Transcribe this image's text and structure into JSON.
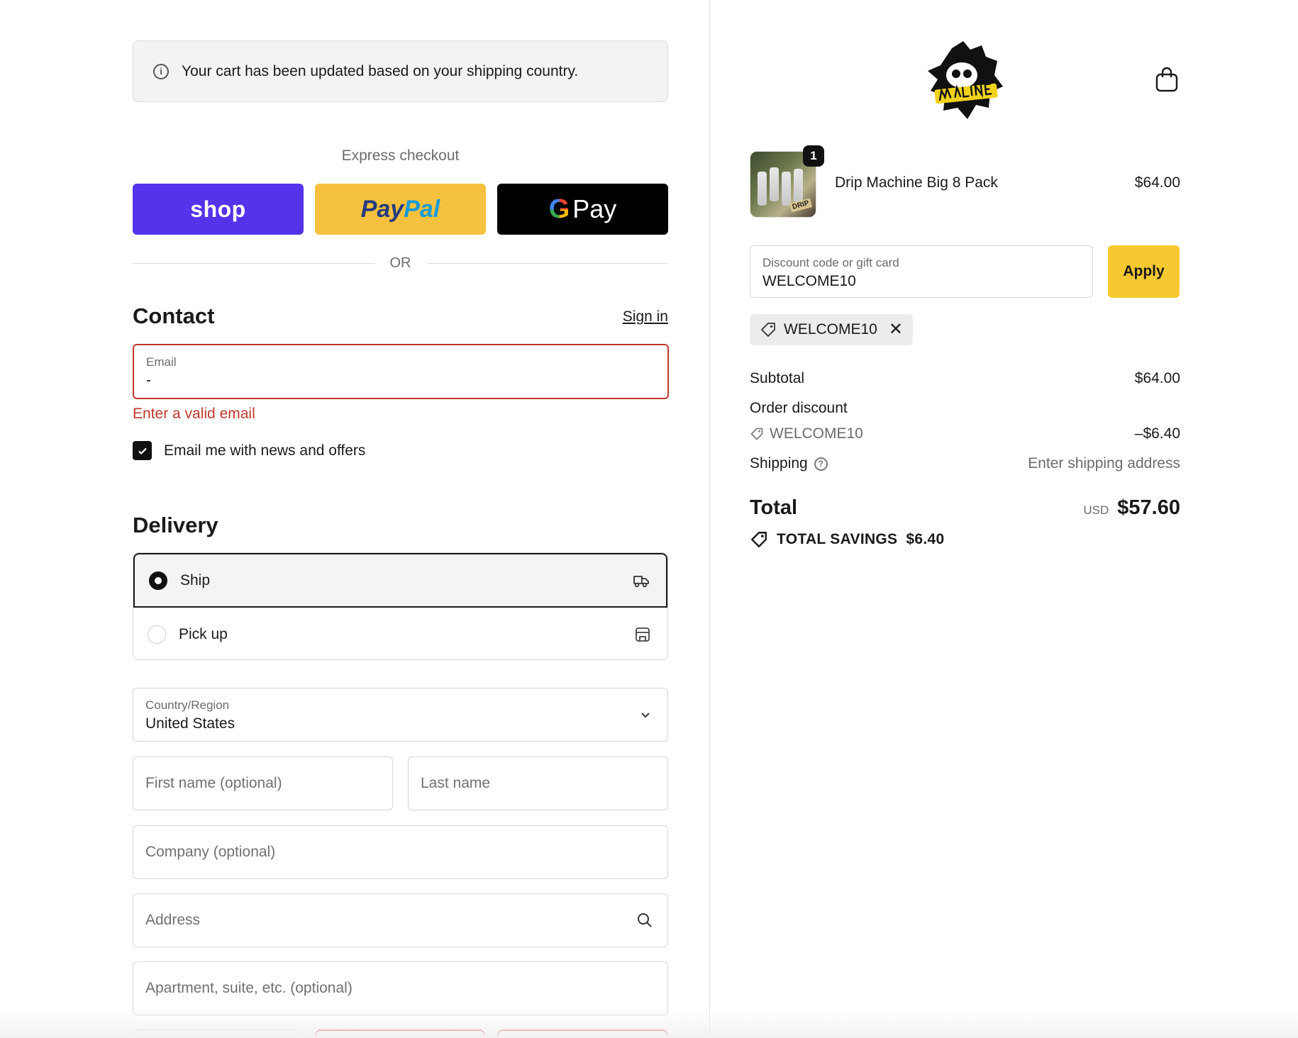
{
  "notice": {
    "text": "Your cart has been updated based on your shipping country."
  },
  "express": {
    "label": "Express checkout",
    "buttons": {
      "shop": "shop",
      "paypal_a": "Pay",
      "paypal_b": "Pal",
      "gpay_g": "G",
      "gpay": "Pay"
    },
    "or": "OR"
  },
  "contact": {
    "heading": "Contact",
    "sign_in": "Sign in",
    "email_label": "Email",
    "email_value": "-",
    "error": "Enter a valid email",
    "newsletter_label": "Email me with news and offers",
    "newsletter_checked": true
  },
  "delivery": {
    "heading": "Delivery",
    "options": [
      {
        "label": "Ship",
        "selected": true,
        "icon": "truck-icon"
      },
      {
        "label": "Pick up",
        "selected": false,
        "icon": "store-icon"
      }
    ],
    "country_label": "Country/Region",
    "country_value": "United States",
    "first_name_placeholder": "First name (optional)",
    "last_name_placeholder": "Last name",
    "company_placeholder": "Company (optional)",
    "address_placeholder": "Address",
    "apartment_placeholder": "Apartment, suite, etc. (optional)"
  },
  "summary": {
    "item": {
      "name": "Drip Machine Big 8 Pack",
      "price": "$64.00",
      "quantity": "1",
      "thumb_text": "DRIP"
    },
    "discount": {
      "label": "Discount code or gift card",
      "value": "WELCOME10",
      "apply": "Apply",
      "applied_code": "WELCOME10"
    },
    "subtotal_label": "Subtotal",
    "subtotal": "$64.00",
    "order_discount_label": "Order discount",
    "order_discount_code": "WELCOME10",
    "order_discount_amount": "–$6.40",
    "shipping_label": "Shipping",
    "shipping_value": "Enter shipping address",
    "total_label": "Total",
    "currency": "USD",
    "total": "$57.60",
    "savings_label": "TOTAL SAVINGS",
    "savings": "$6.40"
  },
  "colors": {
    "shop": "#5433eb",
    "paypal": "#f6c13e",
    "gpay": "#000000",
    "apply": "#f6c931",
    "error": "#c0392b"
  }
}
